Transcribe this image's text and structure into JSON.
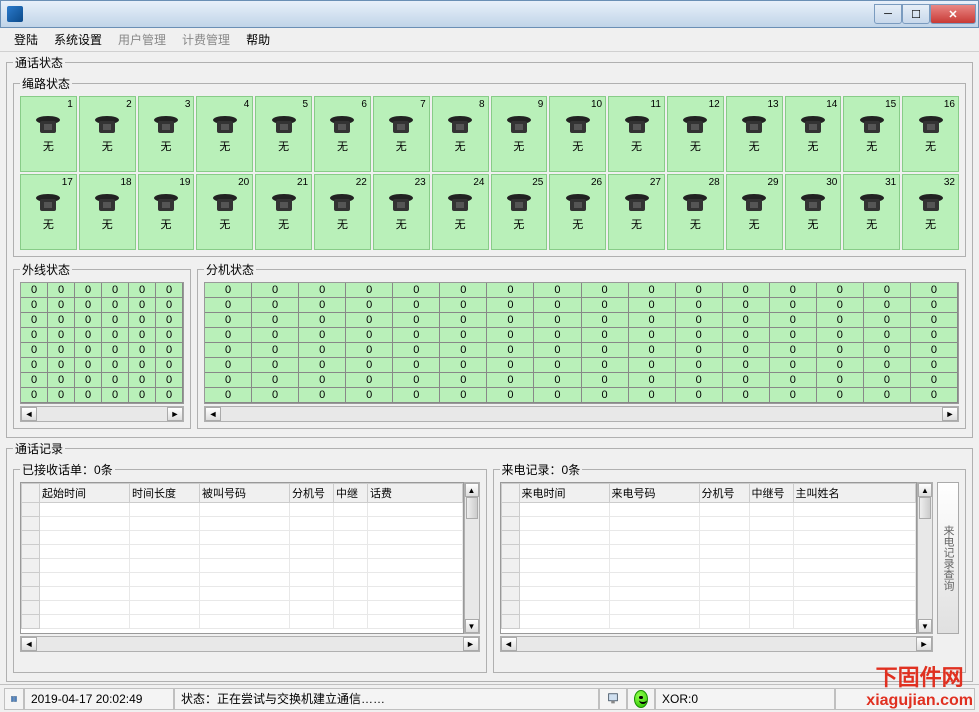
{
  "window": {
    "title": ""
  },
  "menu": {
    "login": "登陆",
    "system": "系统设置",
    "users": "用户管理",
    "billing": "计费管理",
    "help": "帮助"
  },
  "groups": {
    "call_status": "通话状态",
    "trunk_status": "绳路状态",
    "outline_status": "外线状态",
    "ext_status": "分机状态",
    "call_records": "通话记录"
  },
  "trunks": {
    "status_label": "无",
    "count": 32
  },
  "outline": {
    "cell_value": "0",
    "rows": 8,
    "cols": 6
  },
  "ext": {
    "cell_value": "0",
    "rows": 8,
    "cols": 16
  },
  "received": {
    "title_prefix": "已接收话单：",
    "count": "0条",
    "cols": [
      "起始时间",
      "时间长度",
      "被叫号码",
      "分机号",
      "中继",
      "话费"
    ]
  },
  "incoming": {
    "title_prefix": "来电记录：",
    "count": "0条",
    "cols": [
      "来电时间",
      "来电号码",
      "分机号",
      "中继号",
      "主叫姓名"
    ],
    "side_button": "来电记录查询"
  },
  "statusbar": {
    "datetime": "2019-04-17 20:02:49",
    "state_label": "状态：",
    "state_text": "正在尝试与交换机建立通信……",
    "xor": "XOR:0"
  },
  "watermark": {
    "line1": "下固件网",
    "line2": "xiagujian.com"
  }
}
